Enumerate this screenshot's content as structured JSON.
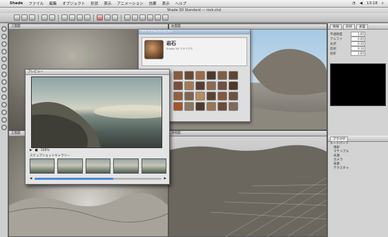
{
  "menubar": {
    "app": "Shade",
    "items": [
      "ファイル",
      "編集",
      "オブジェクト",
      "形状",
      "表示",
      "アニメーション",
      "効果",
      "表示",
      "ヘルプ"
    ],
    "clock": "13:18"
  },
  "window": {
    "title": "Shade 3D Standard — rock.shd"
  },
  "viewports": {
    "top": "上面図",
    "front": "正面図",
    "side": "右面図",
    "perspective": "透視図"
  },
  "material_dialog": {
    "header": "マテリアル/プレビュー",
    "name": "岩石",
    "subtitle": "Shade 3D マテリアル"
  },
  "render_window": {
    "header": "プレビュー",
    "gallery_label": "スナップショットギャラリー",
    "zoom": "100%",
    "progress": 0.62
  },
  "right_panel": {
    "tabs": [
      "情報",
      "形状",
      "表面"
    ],
    "props": [
      {
        "label": "不透明度",
        "value": "1.00"
      },
      {
        "label": "アルファ",
        "value": "0.00"
      },
      {
        "label": "光沢",
        "value": "0.30"
      },
      {
        "label": "反射",
        "value": "0.10"
      },
      {
        "label": "屈折",
        "value": "1.00"
      }
    ],
    "browser_tab": "ブラウザ",
    "tree": [
      "ルートパート",
      "地形",
      "マテリアル",
      "光源",
      "カメラ",
      "背景",
      "テクスチャ"
    ]
  },
  "colors": {
    "accent": "#4a88d8",
    "dialog_header": "#8fa9c8"
  }
}
